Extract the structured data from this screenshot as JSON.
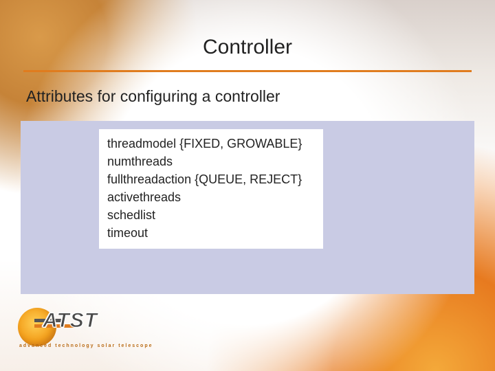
{
  "title": "Controller",
  "subtitle": "Attributes for configuring a controller",
  "attributes": [
    "threadmodel {FIXED, GROWABLE}",
    "numthreads",
    "fullthreadaction {QUEUE, REJECT}",
    "activethreads",
    "schedlist",
    "timeout"
  ],
  "logo": {
    "acronym": "ATST",
    "tagline": "advanced technology solar telescope"
  }
}
